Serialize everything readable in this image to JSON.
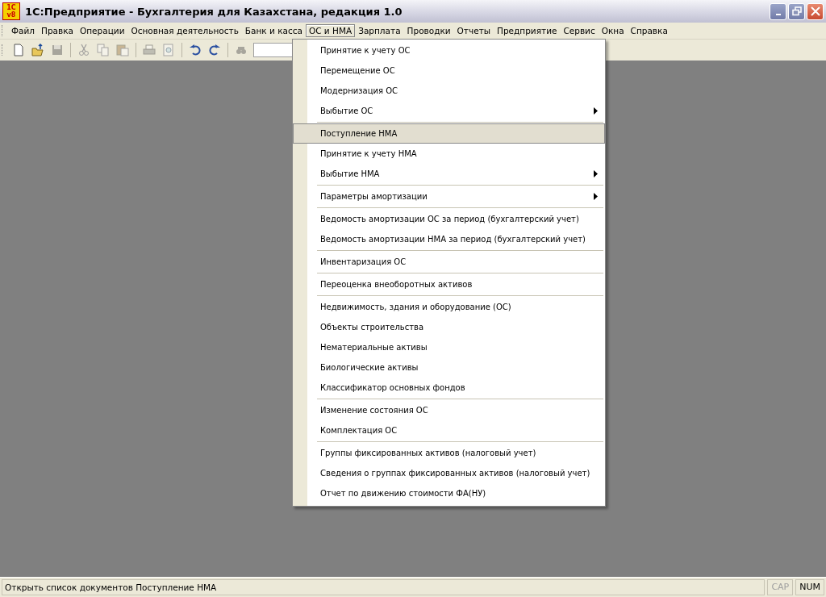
{
  "window": {
    "title": "1С:Предприятие  - Бухгалтерия для Казахстана, редакция 1.0",
    "logo": {
      "top": "1C",
      "bottom": "v8"
    }
  },
  "menu_bar": [
    {
      "label": "Файл",
      "selected": false
    },
    {
      "label": "Правка",
      "selected": false
    },
    {
      "label": "Операции",
      "selected": false
    },
    {
      "label": "Основная деятельность",
      "selected": false
    },
    {
      "label": "Банк и касса",
      "selected": false
    },
    {
      "label": "ОС и НМА",
      "selected": true
    },
    {
      "label": "Зарплата",
      "selected": false
    },
    {
      "label": "Проводки",
      "selected": false
    },
    {
      "label": "Отчеты",
      "selected": false
    },
    {
      "label": "Предприятие",
      "selected": false
    },
    {
      "label": "Сервис",
      "selected": false
    },
    {
      "label": "Окна",
      "selected": false
    },
    {
      "label": "Справка",
      "selected": false
    }
  ],
  "toolbar": [
    {
      "kind": "new",
      "disabled": false
    },
    {
      "kind": "open",
      "disabled": false
    },
    {
      "kind": "save",
      "disabled": true
    },
    {
      "kind": "sep"
    },
    {
      "kind": "cut",
      "disabled": true
    },
    {
      "kind": "copy",
      "disabled": true
    },
    {
      "kind": "paste",
      "disabled": true
    },
    {
      "kind": "sep"
    },
    {
      "kind": "print",
      "disabled": true
    },
    {
      "kind": "preview",
      "disabled": true
    },
    {
      "kind": "sep"
    },
    {
      "kind": "undo",
      "disabled": false
    },
    {
      "kind": "redo",
      "disabled": false
    },
    {
      "kind": "sep"
    },
    {
      "kind": "find",
      "disabled": true
    },
    {
      "kind": "field"
    }
  ],
  "dropdown": [
    [
      {
        "label": "Принятие к учету ОС",
        "submenu": false,
        "selected": false
      },
      {
        "label": "Перемещение ОС",
        "submenu": false,
        "selected": false
      },
      {
        "label": "Модернизация ОС",
        "submenu": false,
        "selected": false
      },
      {
        "label": "Выбытие ОС",
        "submenu": true,
        "selected": false
      }
    ],
    [
      {
        "label": "Поступление НМА",
        "submenu": false,
        "selected": true
      },
      {
        "label": "Принятие к учету НМА",
        "submenu": false,
        "selected": false
      },
      {
        "label": "Выбытие НМА",
        "submenu": true,
        "selected": false
      }
    ],
    [
      {
        "label": "Параметры амортизации",
        "submenu": true,
        "selected": false
      }
    ],
    [
      {
        "label": "Ведомость амортизации ОС за период (бухгалтерский учет)",
        "submenu": false,
        "selected": false
      },
      {
        "label": "Ведомость амортизации НМА за период (бухгалтерский учет)",
        "submenu": false,
        "selected": false
      }
    ],
    [
      {
        "label": "Инвентаризация ОС",
        "submenu": false,
        "selected": false
      }
    ],
    [
      {
        "label": "Переоценка внеоборотных активов",
        "submenu": false,
        "selected": false
      }
    ],
    [
      {
        "label": "Недвижимость, здания и оборудование (ОС)",
        "submenu": false,
        "selected": false
      },
      {
        "label": "Объекты строительства",
        "submenu": false,
        "selected": false
      },
      {
        "label": "Нематериальные активы",
        "submenu": false,
        "selected": false
      },
      {
        "label": "Биологические активы",
        "submenu": false,
        "selected": false
      },
      {
        "label": "Классификатор основных фондов",
        "submenu": false,
        "selected": false
      }
    ],
    [
      {
        "label": "Изменение состояния ОС",
        "submenu": false,
        "selected": false
      },
      {
        "label": "Комплектация ОС",
        "submenu": false,
        "selected": false
      }
    ],
    [
      {
        "label": "Группы фиксированных активов (налоговый учет)",
        "submenu": false,
        "selected": false
      },
      {
        "label": "Сведения о группах фиксированных активов (налоговый учет)",
        "submenu": false,
        "selected": false
      },
      {
        "label": "Отчет по движению стоимости ФА(НУ)",
        "submenu": false,
        "selected": false
      }
    ]
  ],
  "status_bar": {
    "text": "Открыть список документов Поступление НМА",
    "indicators": [
      {
        "label": "CAP",
        "on": false
      },
      {
        "label": "NUM",
        "on": true
      }
    ]
  }
}
